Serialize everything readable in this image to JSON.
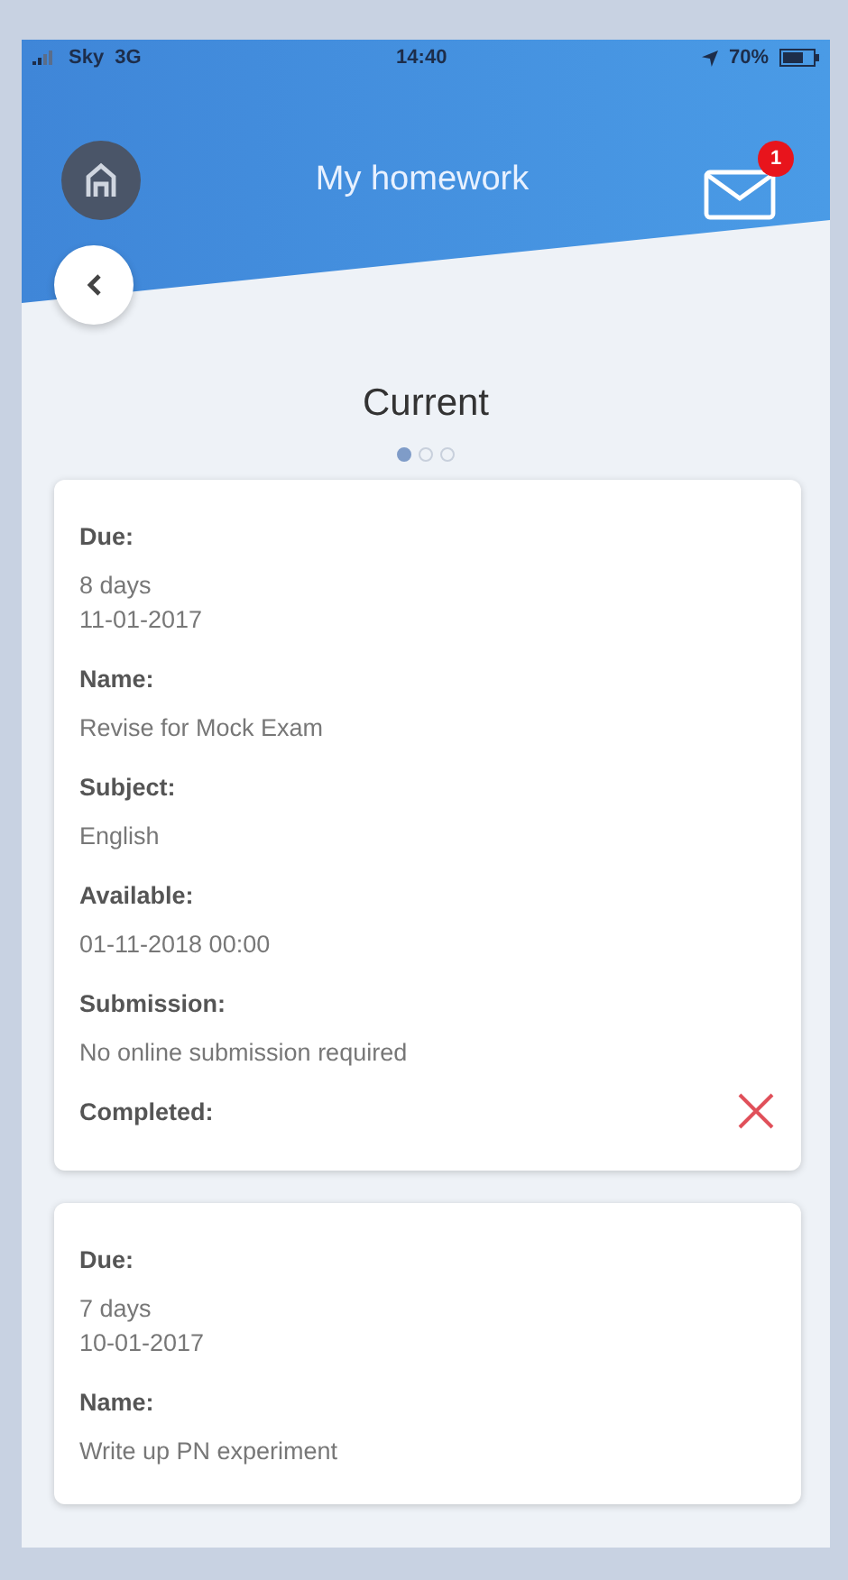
{
  "status_bar": {
    "carrier": "Sky",
    "network": "3G",
    "time": "14:40",
    "battery": "70%"
  },
  "header": {
    "title": "My homework",
    "unread_badge": "1"
  },
  "section": {
    "title": "Current",
    "pages": [
      {
        "selected": true
      },
      {
        "selected": false
      },
      {
        "selected": false
      }
    ]
  },
  "cards": [
    {
      "fields": [
        {
          "label": "Due:",
          "lines": [
            "8 days",
            "11-01-2017"
          ]
        },
        {
          "label": "Name:",
          "lines": [
            "Revise for Mock Exam"
          ]
        },
        {
          "label": "Subject:",
          "lines": [
            "English"
          ]
        },
        {
          "label": "Available:",
          "lines": [
            "01-11-2018 00:00"
          ]
        },
        {
          "label": "Submission:",
          "lines": [
            "No online submission required"
          ]
        }
      ],
      "completed_label": "Completed:",
      "completed": false
    },
    {
      "fields": [
        {
          "label": "Due:",
          "lines": [
            "7 days",
            "10-01-2017"
          ]
        },
        {
          "label": "Name:",
          "lines": [
            "Write up PN experiment"
          ]
        }
      ]
    }
  ]
}
